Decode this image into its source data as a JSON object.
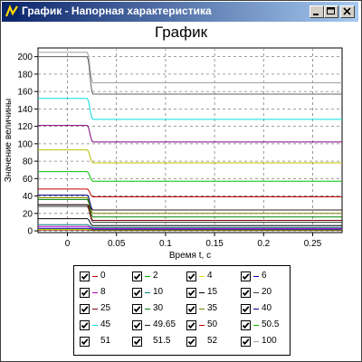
{
  "window": {
    "title": "График - Напорная характеристика",
    "icon": "app-chart-icon"
  },
  "controls": {
    "minimize": "minimize-icon",
    "maximize": "maximize-icon",
    "close": "close-icon"
  },
  "chart_data": {
    "type": "line",
    "title": "График",
    "xlabel": "Время t, с",
    "ylabel": "Значение величины",
    "xlim": [
      -0.03,
      0.28
    ],
    "ylim": [
      -2,
      210
    ],
    "xticks": [
      0,
      0.05,
      0.1,
      0.15,
      0.2,
      0.25
    ],
    "xtick_labels": [
      "0",
      "0.05",
      "0.1",
      "0.15",
      "0.2",
      "0.25"
    ],
    "yticks": [
      0,
      20,
      40,
      60,
      80,
      100,
      120,
      140,
      160,
      180,
      200
    ],
    "ytick_labels": [
      "0",
      "20",
      "40",
      "60",
      "80",
      "100",
      "120",
      "140",
      "160",
      "180",
      "200"
    ],
    "grid": true,
    "legend_position": "bottom",
    "transition": {
      "t_start": 0.02,
      "t_end": 0.026
    },
    "series": [
      {
        "name": "0",
        "color": "#c00000",
        "start": 1,
        "end": 0.5
      },
      {
        "name": "2",
        "color": "#00a000",
        "start": 1.5,
        "end": 1
      },
      {
        "name": "4",
        "color": "#e0e000",
        "start": 2,
        "end": 1.5
      },
      {
        "name": "6",
        "color": "#0000c0",
        "start": 3,
        "end": 2
      },
      {
        "name": "8",
        "color": "#c000c0",
        "start": 5,
        "end": 3
      },
      {
        "name": "10",
        "color": "#008080",
        "start": 7,
        "end": 4
      },
      {
        "name": "15",
        "color": "#000000",
        "start": 14,
        "end": 6
      },
      {
        "name": "20",
        "color": "#404040",
        "start": 28,
        "end": 10
      },
      {
        "name": "25",
        "color": "#800000",
        "start": 30,
        "end": 12
      },
      {
        "name": "30",
        "color": "#008000",
        "start": 36,
        "end": 16
      },
      {
        "name": "35",
        "color": "#808000",
        "start": 38,
        "end": 20
      },
      {
        "name": "40",
        "color": "#000080",
        "start": 41,
        "end": 24
      },
      {
        "name": "45",
        "color": "#00e0e0",
        "start": 152,
        "end": 128
      },
      {
        "name": "49.65",
        "color": "#202020",
        "start": 30,
        "end": 24
      },
      {
        "name": "50",
        "color": "#c00000",
        "start": 48,
        "end": 39
      },
      {
        "name": "50.5",
        "color": "#00c000",
        "start": 68,
        "end": 57
      },
      {
        "name": "51",
        "color": "#c0c000",
        "start": 93,
        "end": 78
      },
      {
        "name": "51.5",
        "color": "#800080",
        "start": 121,
        "end": 102
      },
      {
        "name": "52",
        "color": "#606060",
        "start": 200,
        "end": 157
      },
      {
        "name": "100",
        "color": "#a0a0a0",
        "start": 205,
        "end": 170
      }
    ]
  },
  "legend": {
    "items": [
      {
        "label": "0",
        "color": "#c00000"
      },
      {
        "label": "2",
        "color": "#00a000"
      },
      {
        "label": "4",
        "color": "#e0e000"
      },
      {
        "label": "6",
        "color": "#0000c0"
      },
      {
        "label": "8",
        "color": "#c000c0"
      },
      {
        "label": "10",
        "color": "#008080"
      },
      {
        "label": "15",
        "color": "#000000"
      },
      {
        "label": "20",
        "color": "#404040"
      },
      {
        "label": "25",
        "color": "#800000"
      },
      {
        "label": "30",
        "color": "#008000"
      },
      {
        "label": "35",
        "color": "#808000"
      },
      {
        "label": "40",
        "color": "#000080"
      },
      {
        "label": "45",
        "color": "#00e0e0"
      },
      {
        "label": "49.65",
        "color": "#202020"
      },
      {
        "label": "50",
        "color": "#c00000"
      },
      {
        "label": "50.5",
        "color": "#00c000"
      },
      {
        "label": "51",
        "color": "#ffffff"
      },
      {
        "label": "51.5",
        "color": "#ffffff"
      },
      {
        "label": "52",
        "color": "#ffffff"
      },
      {
        "label": "100",
        "color": "#a0a0a0"
      }
    ]
  }
}
